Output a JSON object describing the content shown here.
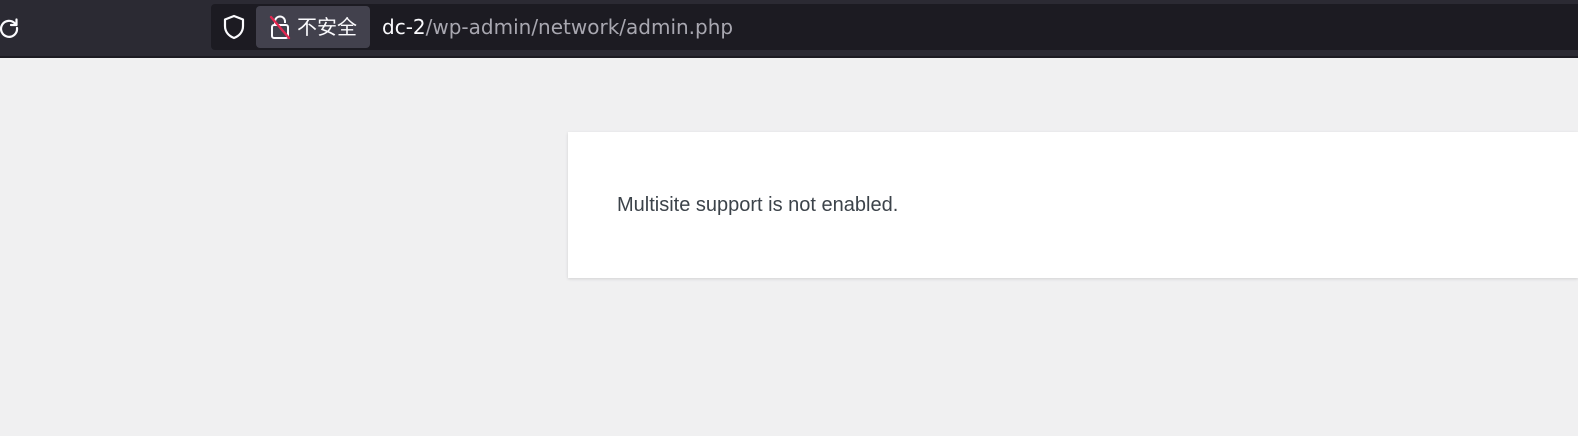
{
  "toolbar": {
    "reload_icon": "reload-icon",
    "shield_icon": "tracking-protection-shield-icon",
    "lock_icon": "insecure-lock-icon",
    "security_label": "不安全",
    "url_host": "dc-2",
    "url_path": "/wp-admin/network/admin.php"
  },
  "page": {
    "message": "Multisite support is not enabled."
  },
  "colors": {
    "toolbar_bg": "#2b2a33",
    "urlbar_bg": "#1c1b22",
    "page_bg": "#f0f0f1",
    "insecure_slash": "#e22850"
  }
}
